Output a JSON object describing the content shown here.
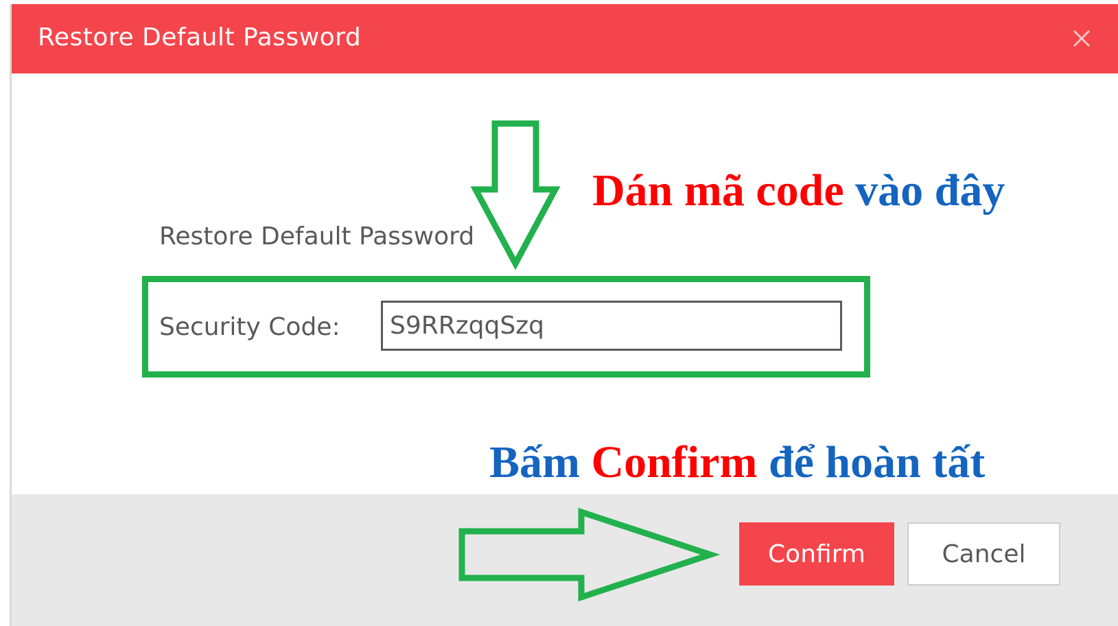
{
  "dialog": {
    "title": "Restore Default Password",
    "close_icon": "close-icon",
    "section_heading": "Restore Default Password",
    "security_code_label": "Security Code:",
    "security_code_value": "S9RRzqqSzq"
  },
  "annotations": {
    "paste_instruction": {
      "part1": "Dán mã code",
      "part2": "vào đây"
    },
    "confirm_instruction": {
      "part1": "Bấm",
      "part2": "Confirm",
      "part3": "để hoàn tất"
    }
  },
  "footer": {
    "confirm_label": "Confirm",
    "cancel_label": "Cancel"
  },
  "colors": {
    "accent": "#f5454c",
    "annotation_green": "#22b14c",
    "annotation_red": "#ff0000",
    "annotation_blue": "#1464c0"
  }
}
